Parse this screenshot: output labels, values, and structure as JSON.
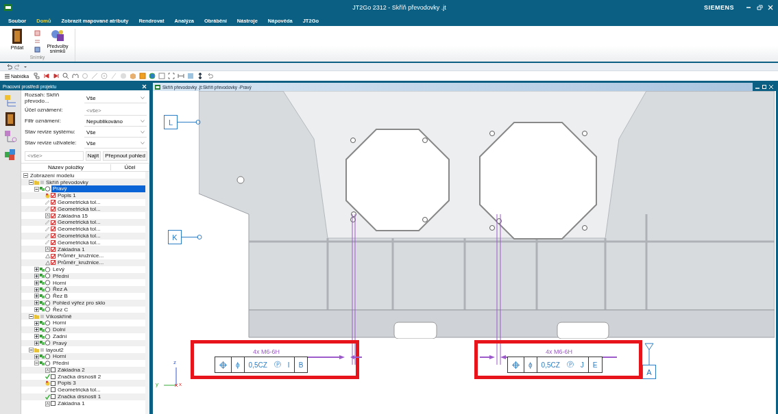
{
  "window": {
    "title": "JT2Go 2312 - Skříň převodovky .jt",
    "brand": "SIEMENS"
  },
  "menu": [
    {
      "label": "Soubor",
      "selected": false
    },
    {
      "label": "Domů",
      "selected": true
    },
    {
      "label": "Zobrazit mapované atributy",
      "selected": false
    },
    {
      "label": "Rendrovat",
      "selected": false
    },
    {
      "label": "Analýza",
      "selected": false
    },
    {
      "label": "Obrábění",
      "selected": false
    },
    {
      "label": "Nástroje",
      "selected": false
    },
    {
      "label": "Nápověda",
      "selected": false
    },
    {
      "label": "JT2Go",
      "selected": false
    }
  ],
  "ribbon": {
    "group": "Snímky",
    "buttons": [
      {
        "label": "Přidat"
      },
      {
        "label": "Předvolby snímků"
      }
    ]
  },
  "toolbar": {
    "menu_label": "Nabídka"
  },
  "panel": {
    "title": "Pracovní prostředí projektu",
    "filters": [
      {
        "kind": "select",
        "label": "Rozsah: Skříň převodo...",
        "value": "Vše"
      },
      {
        "kind": "input",
        "label": "Účel oznámení:",
        "placeholder": "<vše>"
      },
      {
        "kind": "select",
        "label": "Filtr oznámení:",
        "value": "Nepublikováno"
      },
      {
        "kind": "select",
        "label": "Stav revize systému:",
        "value": "Vše"
      },
      {
        "kind": "select",
        "label": "Stav revize uživatele:",
        "value": "Vše"
      }
    ],
    "search": {
      "placeholder": "<vše>"
    },
    "buttons": [
      "Najít",
      "Přepnout pohled"
    ],
    "columns": [
      "Název položky",
      "Účel"
    ],
    "tree": [
      {
        "label": "Zobrazení modelu",
        "expanded": true,
        "selected": false,
        "children": [
          {
            "label": "Skříň převodovky",
            "kind": "model",
            "expanded": true,
            "selected": false,
            "children": [
              {
                "label": "Pravý",
                "kind": "view",
                "expanded": true,
                "selected": true,
                "children": [
                  {
                    "label": "Popis 1",
                    "kind": "note",
                    "checked": true,
                    "selected": false
                  },
                  {
                    "label": "Geometrická tol...",
                    "kind": "gdt",
                    "checked": true,
                    "selected": false
                  },
                  {
                    "label": "Geometrická tol...",
                    "kind": "gdt",
                    "checked": true,
                    "selected": false
                  },
                  {
                    "label": "Základna 15",
                    "kind": "datum",
                    "checked": true,
                    "selected": false
                  },
                  {
                    "label": "Geometrická tol...",
                    "kind": "gdt",
                    "checked": true,
                    "selected": false
                  },
                  {
                    "label": "Geometrická tol...",
                    "kind": "gdt",
                    "checked": true,
                    "selected": false
                  },
                  {
                    "label": "Geometrická tol...",
                    "kind": "gdt",
                    "checked": true,
                    "selected": false
                  },
                  {
                    "label": "Geometrická tol...",
                    "kind": "gdt",
                    "checked": true,
                    "selected": false
                  },
                  {
                    "label": "Základna 1",
                    "kind": "datum",
                    "checked": true,
                    "selected": false
                  },
                  {
                    "label": "Průměr_kružnice...",
                    "kind": "diameter",
                    "checked": true,
                    "selected": false
                  },
                  {
                    "label": "Průměr_kružnice...",
                    "kind": "diameter",
                    "checked": true,
                    "selected": false
                  }
                ]
              },
              {
                "label": "Levý",
                "kind": "view",
                "expanded": false,
                "selected": false
              },
              {
                "label": "Přední",
                "kind": "view",
                "expanded": false,
                "selected": false
              },
              {
                "label": "Horní",
                "kind": "view",
                "expanded": false,
                "selected": false
              },
              {
                "label": "Řez A",
                "kind": "view",
                "expanded": false,
                "selected": false
              },
              {
                "label": "Řez B",
                "kind": "view",
                "expanded": false,
                "selected": false
              },
              {
                "label": "Pohled výřez pro sklo",
                "kind": "view",
                "expanded": false,
                "selected": false
              },
              {
                "label": "Řez C",
                "kind": "view",
                "expanded": false,
                "selected": false
              }
            ]
          },
          {
            "label": "Víkoskříně",
            "kind": "model",
            "expanded": true,
            "selected": false,
            "children": [
              {
                "label": "Horní",
                "kind": "view",
                "expanded": false,
                "selected": false
              },
              {
                "label": "Dolní",
                "kind": "view",
                "expanded": false,
                "selected": false
              },
              {
                "label": "Zadní",
                "kind": "view",
                "expanded": false,
                "selected": false
              },
              {
                "label": "Pravý",
                "kind": "view",
                "expanded": false,
                "selected": false
              }
            ]
          },
          {
            "label": "layout2",
            "kind": "model",
            "expanded": true,
            "selected": false,
            "children": [
              {
                "label": "Horní",
                "kind": "view",
                "expanded": false,
                "selected": false
              },
              {
                "label": "Přední",
                "kind": "view",
                "expanded": true,
                "selected": false,
                "children": [
                  {
                    "label": "Základna 2",
                    "kind": "datum",
                    "checked": false,
                    "selected": false
                  },
                  {
                    "label": "Značka drsnosti 2",
                    "kind": "roughness",
                    "checked": false,
                    "selected": false
                  },
                  {
                    "label": "Popis 3",
                    "kind": "note",
                    "checked": false,
                    "selected": false
                  },
                  {
                    "label": "Geometrická tol...",
                    "kind": "gdt",
                    "checked": false,
                    "selected": false
                  },
                  {
                    "label": "Značka drsnosti 1",
                    "kind": "roughness",
                    "checked": false,
                    "selected": false
                  },
                  {
                    "label": "Základna 1",
                    "kind": "datum",
                    "checked": false,
                    "selected": false
                  }
                ]
              }
            ]
          }
        ]
      }
    ]
  },
  "viewport": {
    "title": "Skříň převodovky .jt:Skříň převodovky -Pravý",
    "datums": [
      {
        "letter": "L"
      },
      {
        "letter": "K"
      },
      {
        "letter": "A"
      }
    ],
    "frames": [
      {
        "note": "4x M6-6H",
        "cells": [
          [
            "ϕ"
          ],
          [
            "0,5CZ",
            "Ⓟ",
            "I"
          ],
          [
            "B"
          ]
        ]
      },
      {
        "note": "4x M6-6H",
        "cells": [
          [
            "ϕ"
          ],
          [
            "0,5CZ",
            "Ⓟ",
            "J"
          ],
          [
            "E"
          ]
        ]
      }
    ],
    "axes": [
      {
        "label": "z"
      },
      {
        "label": "y"
      },
      {
        "label": "x"
      }
    ]
  }
}
